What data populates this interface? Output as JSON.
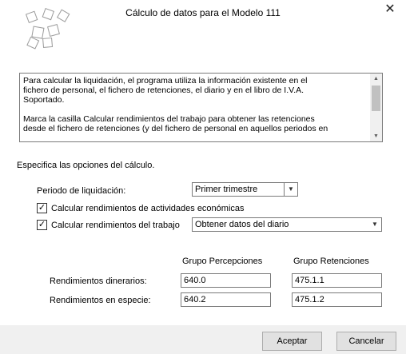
{
  "window": {
    "title": "Cálculo de datos para el Modelo 111",
    "close_icon": "close-icon"
  },
  "description": {
    "text": "Para calcular la liquidación, el programa utiliza la información existente en el\nfichero de personal, el fichero de retenciones, el diario y en el libro de I.V.A.\nSoportado.\n\nMarca la casilla Calcular rendimientos del trabajo para obtener las retenciones\ndesde el fichero de retenciones (y del fichero de personal en aquellos periodos en"
  },
  "options": {
    "heading": "Especifica las opciones del cálculo.",
    "periodo_label": "Periodo de liquidación:",
    "periodo_value": "Primer trimestre",
    "actividades_label": "Calcular rendimientos de actividades económicas",
    "actividades_checked": true,
    "trabajo_label": "Calcular rendimientos del trabajo",
    "trabajo_checked": true,
    "trabajo_value": "Obtener datos del diario"
  },
  "grid": {
    "col_percepciones": "Grupo Percepciones",
    "col_retenciones": "Grupo Retenciones",
    "rows": [
      {
        "label": "Rendimientos dinerarios:",
        "percepciones": "640.0",
        "retenciones": "475.1.1"
      },
      {
        "label": "Rendimientos en especie:",
        "percepciones": "640.2",
        "retenciones": "475.1.2"
      }
    ]
  },
  "buttons": {
    "accept": "Aceptar",
    "cancel": "Cancelar"
  }
}
